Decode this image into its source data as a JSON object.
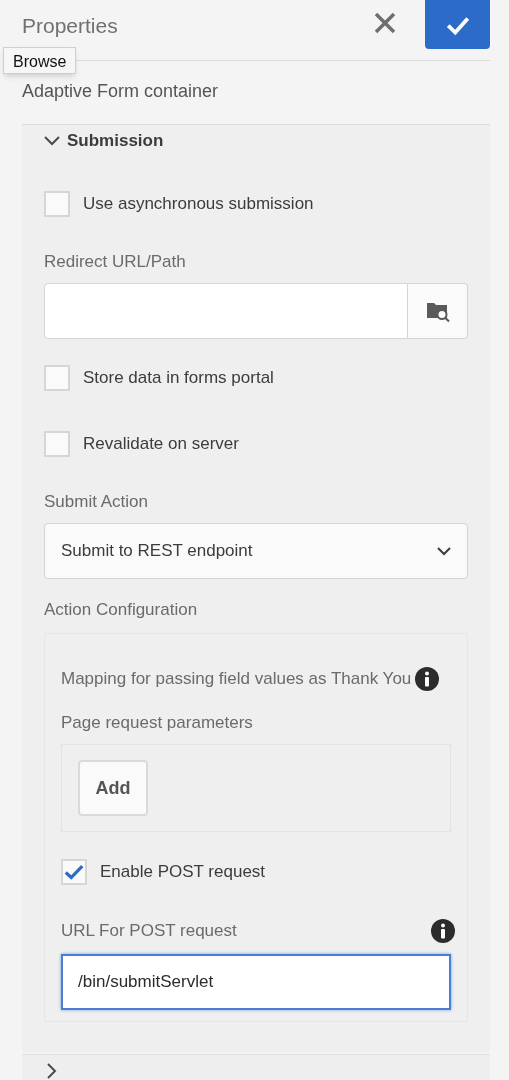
{
  "header": {
    "title": "Properties",
    "tooltip": "Browse"
  },
  "component_title": "Adaptive Form container",
  "section": {
    "title": "Submission",
    "expanded": true,
    "fields": [
      {
        "kind": "checkbox",
        "label": "Use asynchronous submission",
        "checked": false
      },
      {
        "kind": "path",
        "label": "Redirect URL/Path"
      },
      {
        "kind": "checkbox",
        "label": "Store data in forms portal",
        "checked": false
      },
      {
        "kind": "checkbox",
        "label": "Revalidate on server",
        "checked": false
      },
      {
        "kind": "select",
        "label": "Submit Action",
        "value": "Submit to REST endpoint"
      },
      {
        "kind": "group",
        "label": "Action Configuration",
        "items": [
          {
            "kind": "multifield",
            "label": "Mapping for passing field values as Thank You",
            "label_2": "Page request parameters",
            "info": true,
            "button": "Add"
          },
          {
            "kind": "checkbox",
            "label": "Enable POST request",
            "checked": true
          },
          {
            "kind": "text",
            "label": "URL For POST request",
            "info": true,
            "value": "/bin/submitServlet",
            "focused": true
          }
        ]
      }
    ]
  },
  "next_section": {
    "expanded": false
  }
}
